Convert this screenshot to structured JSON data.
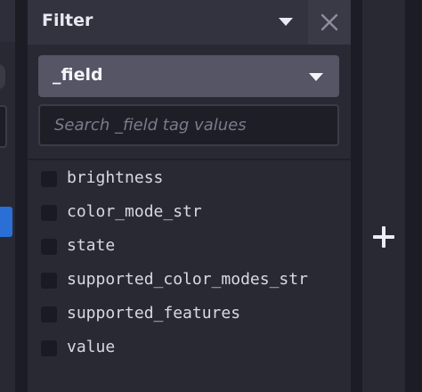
{
  "filter_panel": {
    "title": "Filter",
    "field_selector": {
      "selected": "_field"
    },
    "search": {
      "placeholder": "Search _field tag values",
      "value": ""
    },
    "values": [
      {
        "label": "brightness",
        "checked": false
      },
      {
        "label": "color_mode_str",
        "checked": false
      },
      {
        "label": "state",
        "checked": false
      },
      {
        "label": "supported_color_modes_str",
        "checked": false
      },
      {
        "label": "supported_features",
        "checked": false
      },
      {
        "label": "value",
        "checked": false
      }
    ]
  },
  "icons": {
    "collapse": "chevron-down-icon",
    "close": "close-icon",
    "dropdown": "chevron-down-icon",
    "add": "plus-icon"
  },
  "colors": {
    "panel_bg": "#292933",
    "header_bg": "#333340",
    "selected_accent": "#2a6fd6"
  }
}
